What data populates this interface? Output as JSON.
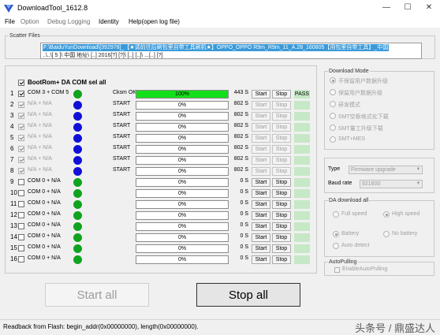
{
  "window": {
    "title": "DownloadTool_1612.8",
    "controls": [
      "—",
      "☐",
      "✕"
    ]
  },
  "menu": [
    {
      "label": "File",
      "disabled": false
    },
    {
      "label": "Option",
      "disabled": true
    },
    {
      "label": "Debug Logging",
      "disabled": true
    },
    {
      "label": "Identity",
      "disabled": false
    },
    {
      "label": "Help(open log file)",
      "disabled": false
    }
  ],
  "scatter": {
    "label": "Scatter Files",
    "line1": "F:\\BaiduYunDownload\\[392978]_【★请前往后刷包里自带工具刷机★】OPPO_OPPO R9m_R9m_11_A.28_160805【用包里自带工具】_中国",
    "line2": "..\\..\\[ 5 ]\\ 中国 地址\\ [..] 2016[?] [?]\\ [..] [..]\\ ...[..] [?]"
  },
  "bootrom": {
    "label": "BootRom+ DA COM sel all",
    "checked": true
  },
  "colors": {
    "green": "#0fa31f",
    "blue": "#1010d8",
    "fill": "#13e01a"
  },
  "ports": [
    {
      "num": "1",
      "checked": true,
      "enabled": true,
      "label": "COM 3 + COM 5",
      "dot": "green",
      "status": "Cksm OK",
      "progress": "100%",
      "pct": 100,
      "time": "443 S",
      "pass": "PASS"
    },
    {
      "num": "2",
      "checked": true,
      "enabled": false,
      "label": "N/A + N/A",
      "dot": "blue",
      "status": "START",
      "progress": "0%",
      "pct": 0,
      "time": "802 S",
      "pass": ""
    },
    {
      "num": "3",
      "checked": true,
      "enabled": false,
      "label": "N/A + N/A",
      "dot": "blue",
      "status": "START",
      "progress": "0%",
      "pct": 0,
      "time": "802 S",
      "pass": ""
    },
    {
      "num": "4",
      "checked": true,
      "enabled": false,
      "label": "N/A + N/A",
      "dot": "blue",
      "status": "START",
      "progress": "0%",
      "pct": 0,
      "time": "802 S",
      "pass": ""
    },
    {
      "num": "5",
      "checked": true,
      "enabled": false,
      "label": "N/A + N/A",
      "dot": "blue",
      "status": "START",
      "progress": "0%",
      "pct": 0,
      "time": "802 S",
      "pass": ""
    },
    {
      "num": "6",
      "checked": true,
      "enabled": false,
      "label": "N/A + N/A",
      "dot": "blue",
      "status": "START",
      "progress": "0%",
      "pct": 0,
      "time": "802 S",
      "pass": ""
    },
    {
      "num": "7",
      "checked": true,
      "enabled": false,
      "label": "N/A + N/A",
      "dot": "blue",
      "status": "START",
      "progress": "0%",
      "pct": 0,
      "time": "802 S",
      "pass": ""
    },
    {
      "num": "8",
      "checked": true,
      "enabled": false,
      "label": "N/A + N/A",
      "dot": "blue",
      "status": "START",
      "progress": "0%",
      "pct": 0,
      "time": "802 S",
      "pass": ""
    },
    {
      "num": "9",
      "checked": false,
      "enabled": true,
      "label": "COM 0 + N/A",
      "dot": "green",
      "status": "",
      "progress": "0%",
      "pct": 0,
      "time": "0 S",
      "pass": ""
    },
    {
      "num": "10",
      "checked": false,
      "enabled": true,
      "label": "COM 0 + N/A",
      "dot": "green",
      "status": "",
      "progress": "0%",
      "pct": 0,
      "time": "0 S",
      "pass": ""
    },
    {
      "num": "11",
      "checked": false,
      "enabled": true,
      "label": "COM 0 + N/A",
      "dot": "green",
      "status": "",
      "progress": "0%",
      "pct": 0,
      "time": "0 S",
      "pass": ""
    },
    {
      "num": "12",
      "checked": false,
      "enabled": true,
      "label": "COM 0 + N/A",
      "dot": "green",
      "status": "",
      "progress": "0%",
      "pct": 0,
      "time": "0 S",
      "pass": ""
    },
    {
      "num": "13",
      "checked": false,
      "enabled": true,
      "label": "COM 0 + N/A",
      "dot": "green",
      "status": "",
      "progress": "0%",
      "pct": 0,
      "time": "0 S",
      "pass": ""
    },
    {
      "num": "14",
      "checked": false,
      "enabled": true,
      "label": "COM 0 + N/A",
      "dot": "green",
      "status": "",
      "progress": "0%",
      "pct": 0,
      "time": "0 S",
      "pass": ""
    },
    {
      "num": "15",
      "checked": false,
      "enabled": true,
      "label": "COM 0 + N/A",
      "dot": "green",
      "status": "",
      "progress": "0%",
      "pct": 0,
      "time": "0 S",
      "pass": ""
    },
    {
      "num": "16",
      "checked": false,
      "enabled": true,
      "label": "COM 0 + N/A",
      "dot": "green",
      "status": "",
      "progress": "0%",
      "pct": 0,
      "time": "0 S",
      "pass": ""
    }
  ],
  "row_buttons": {
    "start": "Start",
    "stop": "Stop"
  },
  "download_mode": {
    "label": "Download Mode",
    "options": [
      "不保留用户数据升级",
      "保留用户数据升级",
      "研发模式",
      "SMT空板格式化下载",
      "SMT量工升级下载",
      "SMT+MES"
    ],
    "selected": 0
  },
  "type": {
    "label": "Type",
    "value": "Firmware upgrade"
  },
  "baud": {
    "label": "Baud rate",
    "value": "921600"
  },
  "da": {
    "label": "DA download all",
    "speed_options": [
      "Full speed",
      "High speed"
    ],
    "speed_selected": 1,
    "battery_options": [
      "Battery",
      "No battery",
      "Auto detect"
    ],
    "battery_selected": 0
  },
  "autopulling": {
    "label": "AutoPulling",
    "checkbox": "EnableAutoPulling"
  },
  "actions": {
    "start_all": "Start all",
    "stop_all": "Stop all"
  },
  "status": {
    "text": "Readback from Flash:  begin_addr(0x00000000), length(0x00000000)."
  },
  "watermark": "头条号 / 鼎盛达人"
}
